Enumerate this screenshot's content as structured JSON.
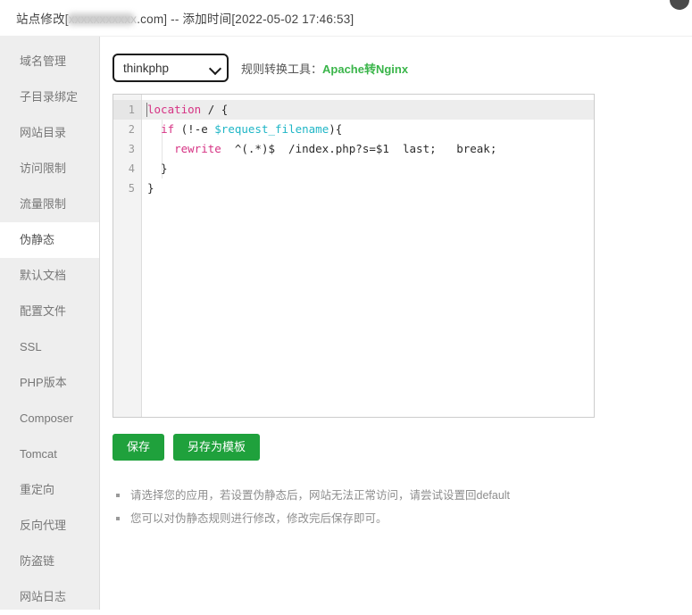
{
  "header": {
    "title_prefix": "站点修改[",
    "title_domain_redacted": "xxxxxxxxxxx",
    "title_suffix": ".com] -- 添加时间[2022-05-02 17:46:53]",
    "corner_icon": "circle-icon"
  },
  "sidebar": {
    "items": [
      {
        "label": "域名管理",
        "active": false
      },
      {
        "label": "子目录绑定",
        "active": false
      },
      {
        "label": "网站目录",
        "active": false
      },
      {
        "label": "访问限制",
        "active": false
      },
      {
        "label": "流量限制",
        "active": false
      },
      {
        "label": "伪静态",
        "active": true
      },
      {
        "label": "默认文档",
        "active": false
      },
      {
        "label": "配置文件",
        "active": false
      },
      {
        "label": "SSL",
        "active": false
      },
      {
        "label": "PHP版本",
        "active": false
      },
      {
        "label": "Composer",
        "active": false
      },
      {
        "label": "Tomcat",
        "active": false
      },
      {
        "label": "重定向",
        "active": false
      },
      {
        "label": "反向代理",
        "active": false
      },
      {
        "label": "防盗链",
        "active": false
      },
      {
        "label": "网站日志",
        "active": false
      }
    ]
  },
  "toolbar": {
    "select_value": "thinkphp",
    "select_options": [
      "thinkphp"
    ],
    "converter_label": "规则转换工具：",
    "converter_link": "Apache转Nginx",
    "link_color": "#3ab54a"
  },
  "editor": {
    "line_numbers": [
      "1",
      "2",
      "3",
      "4",
      "5"
    ],
    "lines": [
      {
        "n": "1",
        "segments": [
          {
            "text": "location",
            "cls": "kw"
          },
          {
            "text": " / {",
            "cls": "plain"
          }
        ]
      },
      {
        "n": "2",
        "segments": [
          {
            "text": "  ",
            "cls": "plain"
          },
          {
            "text": "if",
            "cls": "kw"
          },
          {
            "text": " (!-e ",
            "cls": "plain"
          },
          {
            "text": "$request_filename",
            "cls": "var"
          },
          {
            "text": "){",
            "cls": "plain"
          }
        ]
      },
      {
        "n": "3",
        "segments": [
          {
            "text": "    ",
            "cls": "plain"
          },
          {
            "text": "rewrite",
            "cls": "kw"
          },
          {
            "text": "  ^(.*)$  /index.php?s=$1  last;   break;",
            "cls": "plain"
          }
        ]
      },
      {
        "n": "4",
        "segments": [
          {
            "text": "  }",
            "cls": "plain"
          }
        ]
      },
      {
        "n": "5",
        "segments": [
          {
            "text": "}",
            "cls": "plain"
          }
        ]
      }
    ]
  },
  "buttons": {
    "save_label": "保存",
    "save_as_template_label": "另存为模板",
    "color": "#1fa13c"
  },
  "notes": [
    "请选择您的应用，若设置伪静态后，网站无法正常访问，请尝试设置回default",
    "您可以对伪静态规则进行修改，修改完后保存即可。"
  ]
}
